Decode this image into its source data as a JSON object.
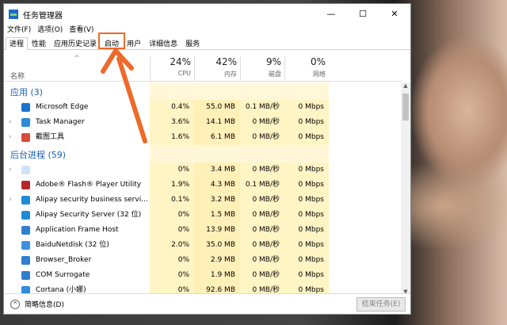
{
  "window": {
    "title": "任务管理器",
    "controls": [
      "—",
      "☐",
      "✕"
    ]
  },
  "menu": [
    "文件(F)",
    "选项(O)",
    "查看(V)"
  ],
  "tabs": [
    "进程",
    "性能",
    "应用历史记录",
    "启动",
    "用户",
    "详细信息",
    "服务"
  ],
  "highlighted_tab": "启动",
  "header": {
    "name_label": "名称",
    "columns": [
      {
        "pct": "24%",
        "label": "CPU"
      },
      {
        "pct": "42%",
        "label": "内存"
      },
      {
        "pct": "9%",
        "label": "磁盘"
      },
      {
        "pct": "0%",
        "label": "网络"
      }
    ]
  },
  "groups": [
    {
      "title": "应用 (3)",
      "rows": [
        {
          "name": "Microsoft Edge",
          "expand": "",
          "icon": "edge-icon",
          "cpu": "0.4%",
          "mem": "55.0 MB",
          "disk": "0.1 MB/秒",
          "net": "0 Mbps"
        },
        {
          "name": "Task Manager",
          "expand": "›",
          "icon": "taskmgr-icon",
          "cpu": "3.6%",
          "mem": "14.1 MB",
          "disk": "0 MB/秒",
          "net": "0 Mbps"
        },
        {
          "name": "截图工具",
          "expand": "›",
          "icon": "snipping-icon",
          "cpu": "1.6%",
          "mem": "6.1 MB",
          "disk": "0 MB/秒",
          "net": "0 Mbps"
        }
      ]
    },
    {
      "title": "后台进程 (59)",
      "rows": [
        {
          "name": "",
          "expand": "›",
          "icon": "blank-app-icon",
          "cpu": "0%",
          "mem": "3.4 MB",
          "disk": "0 MB/秒",
          "net": "0 Mbps"
        },
        {
          "name": "Adobe® Flash® Player Utility",
          "expand": "",
          "icon": "flash-icon",
          "cpu": "1.9%",
          "mem": "4.3 MB",
          "disk": "0.1 MB/秒",
          "net": "0 Mbps"
        },
        {
          "name": "Alipay security business servi...",
          "expand": "›",
          "icon": "alipay-icon",
          "cpu": "0.1%",
          "mem": "3.2 MB",
          "disk": "0 MB/秒",
          "net": "0 Mbps"
        },
        {
          "name": "Alipay Security Server (32 位)",
          "expand": "",
          "icon": "alipay-icon",
          "cpu": "0%",
          "mem": "1.5 MB",
          "disk": "0 MB/秒",
          "net": "0 Mbps"
        },
        {
          "name": "Application Frame Host",
          "expand": "",
          "icon": "app-frame-icon",
          "cpu": "0%",
          "mem": "13.9 MB",
          "disk": "0 MB/秒",
          "net": "0 Mbps"
        },
        {
          "name": "BaiduNetdisk (32 位)",
          "expand": "",
          "icon": "baidu-icon",
          "cpu": "2.0%",
          "mem": "35.0 MB",
          "disk": "0 MB/秒",
          "net": "0 Mbps"
        },
        {
          "name": "Browser_Broker",
          "expand": "",
          "icon": "app-frame-icon",
          "cpu": "0%",
          "mem": "2.9 MB",
          "disk": "0 MB/秒",
          "net": "0 Mbps"
        },
        {
          "name": "COM Surrogate",
          "expand": "",
          "icon": "app-frame-icon",
          "cpu": "0%",
          "mem": "1.9 MB",
          "disk": "0 MB/秒",
          "net": "0 Mbps"
        },
        {
          "name": "Cortana (小娜)",
          "expand": "",
          "icon": "cortana-icon",
          "cpu": "0%",
          "mem": "92.6 MB",
          "disk": "0 MB/秒",
          "net": "0 Mbps"
        }
      ]
    }
  ],
  "footer": {
    "less_label": "简略信息(D)",
    "end_task_label": "结束任务(E)"
  },
  "colors": {
    "highlight": "#ee6a2a",
    "cpu_col": "#fff4c4",
    "mem_col": "#fff0b8",
    "group_title": "#1a5fb4"
  }
}
